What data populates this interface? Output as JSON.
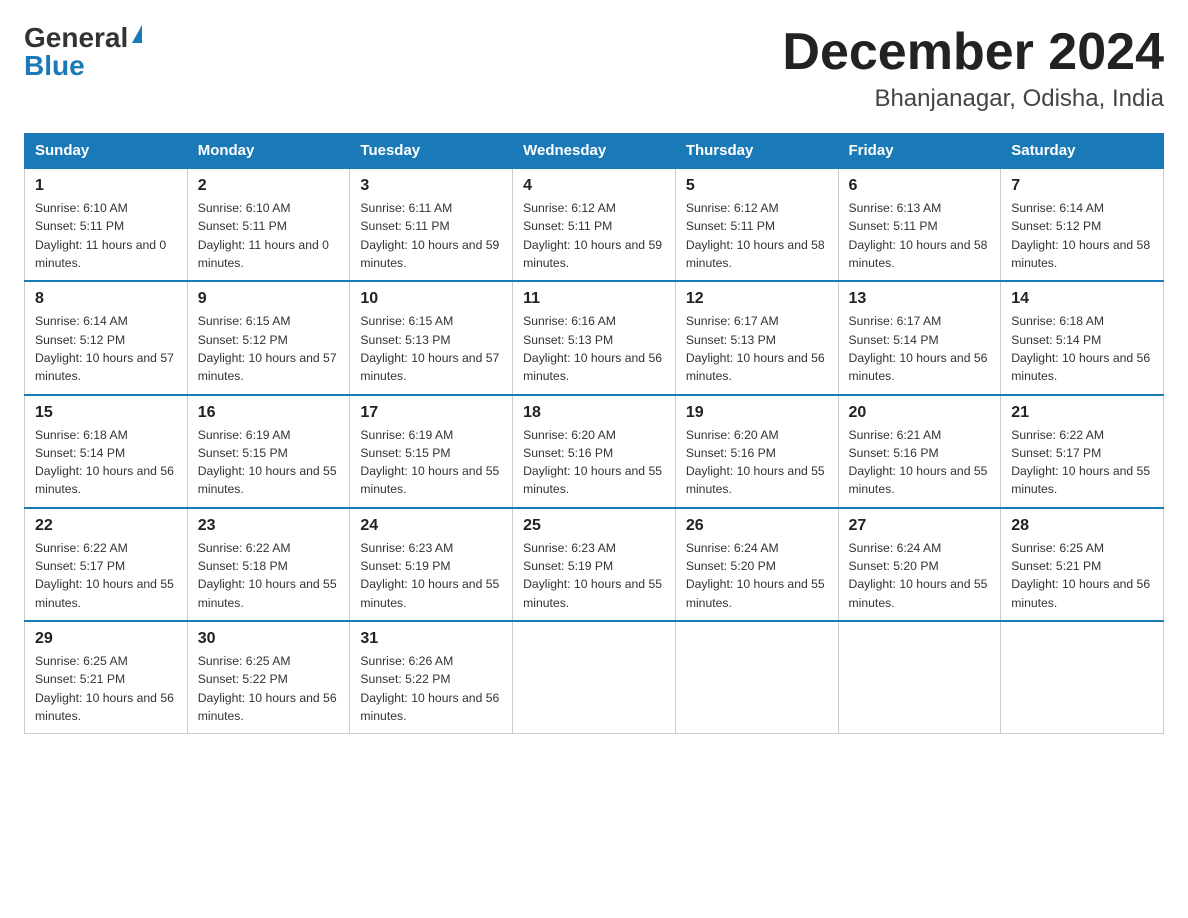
{
  "header": {
    "logo_general": "General",
    "logo_blue": "Blue",
    "month_title": "December 2024",
    "location": "Bhanjanagar, Odisha, India"
  },
  "weekdays": [
    "Sunday",
    "Monday",
    "Tuesday",
    "Wednesday",
    "Thursday",
    "Friday",
    "Saturday"
  ],
  "weeks": [
    [
      {
        "day": "1",
        "sunrise": "6:10 AM",
        "sunset": "5:11 PM",
        "daylight": "11 hours and 0 minutes."
      },
      {
        "day": "2",
        "sunrise": "6:10 AM",
        "sunset": "5:11 PM",
        "daylight": "11 hours and 0 minutes."
      },
      {
        "day": "3",
        "sunrise": "6:11 AM",
        "sunset": "5:11 PM",
        "daylight": "10 hours and 59 minutes."
      },
      {
        "day": "4",
        "sunrise": "6:12 AM",
        "sunset": "5:11 PM",
        "daylight": "10 hours and 59 minutes."
      },
      {
        "day": "5",
        "sunrise": "6:12 AM",
        "sunset": "5:11 PM",
        "daylight": "10 hours and 58 minutes."
      },
      {
        "day": "6",
        "sunrise": "6:13 AM",
        "sunset": "5:11 PM",
        "daylight": "10 hours and 58 minutes."
      },
      {
        "day": "7",
        "sunrise": "6:14 AM",
        "sunset": "5:12 PM",
        "daylight": "10 hours and 58 minutes."
      }
    ],
    [
      {
        "day": "8",
        "sunrise": "6:14 AM",
        "sunset": "5:12 PM",
        "daylight": "10 hours and 57 minutes."
      },
      {
        "day": "9",
        "sunrise": "6:15 AM",
        "sunset": "5:12 PM",
        "daylight": "10 hours and 57 minutes."
      },
      {
        "day": "10",
        "sunrise": "6:15 AM",
        "sunset": "5:13 PM",
        "daylight": "10 hours and 57 minutes."
      },
      {
        "day": "11",
        "sunrise": "6:16 AM",
        "sunset": "5:13 PM",
        "daylight": "10 hours and 56 minutes."
      },
      {
        "day": "12",
        "sunrise": "6:17 AM",
        "sunset": "5:13 PM",
        "daylight": "10 hours and 56 minutes."
      },
      {
        "day": "13",
        "sunrise": "6:17 AM",
        "sunset": "5:14 PM",
        "daylight": "10 hours and 56 minutes."
      },
      {
        "day": "14",
        "sunrise": "6:18 AM",
        "sunset": "5:14 PM",
        "daylight": "10 hours and 56 minutes."
      }
    ],
    [
      {
        "day": "15",
        "sunrise": "6:18 AM",
        "sunset": "5:14 PM",
        "daylight": "10 hours and 56 minutes."
      },
      {
        "day": "16",
        "sunrise": "6:19 AM",
        "sunset": "5:15 PM",
        "daylight": "10 hours and 55 minutes."
      },
      {
        "day": "17",
        "sunrise": "6:19 AM",
        "sunset": "5:15 PM",
        "daylight": "10 hours and 55 minutes."
      },
      {
        "day": "18",
        "sunrise": "6:20 AM",
        "sunset": "5:16 PM",
        "daylight": "10 hours and 55 minutes."
      },
      {
        "day": "19",
        "sunrise": "6:20 AM",
        "sunset": "5:16 PM",
        "daylight": "10 hours and 55 minutes."
      },
      {
        "day": "20",
        "sunrise": "6:21 AM",
        "sunset": "5:16 PM",
        "daylight": "10 hours and 55 minutes."
      },
      {
        "day": "21",
        "sunrise": "6:22 AM",
        "sunset": "5:17 PM",
        "daylight": "10 hours and 55 minutes."
      }
    ],
    [
      {
        "day": "22",
        "sunrise": "6:22 AM",
        "sunset": "5:17 PM",
        "daylight": "10 hours and 55 minutes."
      },
      {
        "day": "23",
        "sunrise": "6:22 AM",
        "sunset": "5:18 PM",
        "daylight": "10 hours and 55 minutes."
      },
      {
        "day": "24",
        "sunrise": "6:23 AM",
        "sunset": "5:19 PM",
        "daylight": "10 hours and 55 minutes."
      },
      {
        "day": "25",
        "sunrise": "6:23 AM",
        "sunset": "5:19 PM",
        "daylight": "10 hours and 55 minutes."
      },
      {
        "day": "26",
        "sunrise": "6:24 AM",
        "sunset": "5:20 PM",
        "daylight": "10 hours and 55 minutes."
      },
      {
        "day": "27",
        "sunrise": "6:24 AM",
        "sunset": "5:20 PM",
        "daylight": "10 hours and 55 minutes."
      },
      {
        "day": "28",
        "sunrise": "6:25 AM",
        "sunset": "5:21 PM",
        "daylight": "10 hours and 56 minutes."
      }
    ],
    [
      {
        "day": "29",
        "sunrise": "6:25 AM",
        "sunset": "5:21 PM",
        "daylight": "10 hours and 56 minutes."
      },
      {
        "day": "30",
        "sunrise": "6:25 AM",
        "sunset": "5:22 PM",
        "daylight": "10 hours and 56 minutes."
      },
      {
        "day": "31",
        "sunrise": "6:26 AM",
        "sunset": "5:22 PM",
        "daylight": "10 hours and 56 minutes."
      },
      null,
      null,
      null,
      null
    ]
  ]
}
